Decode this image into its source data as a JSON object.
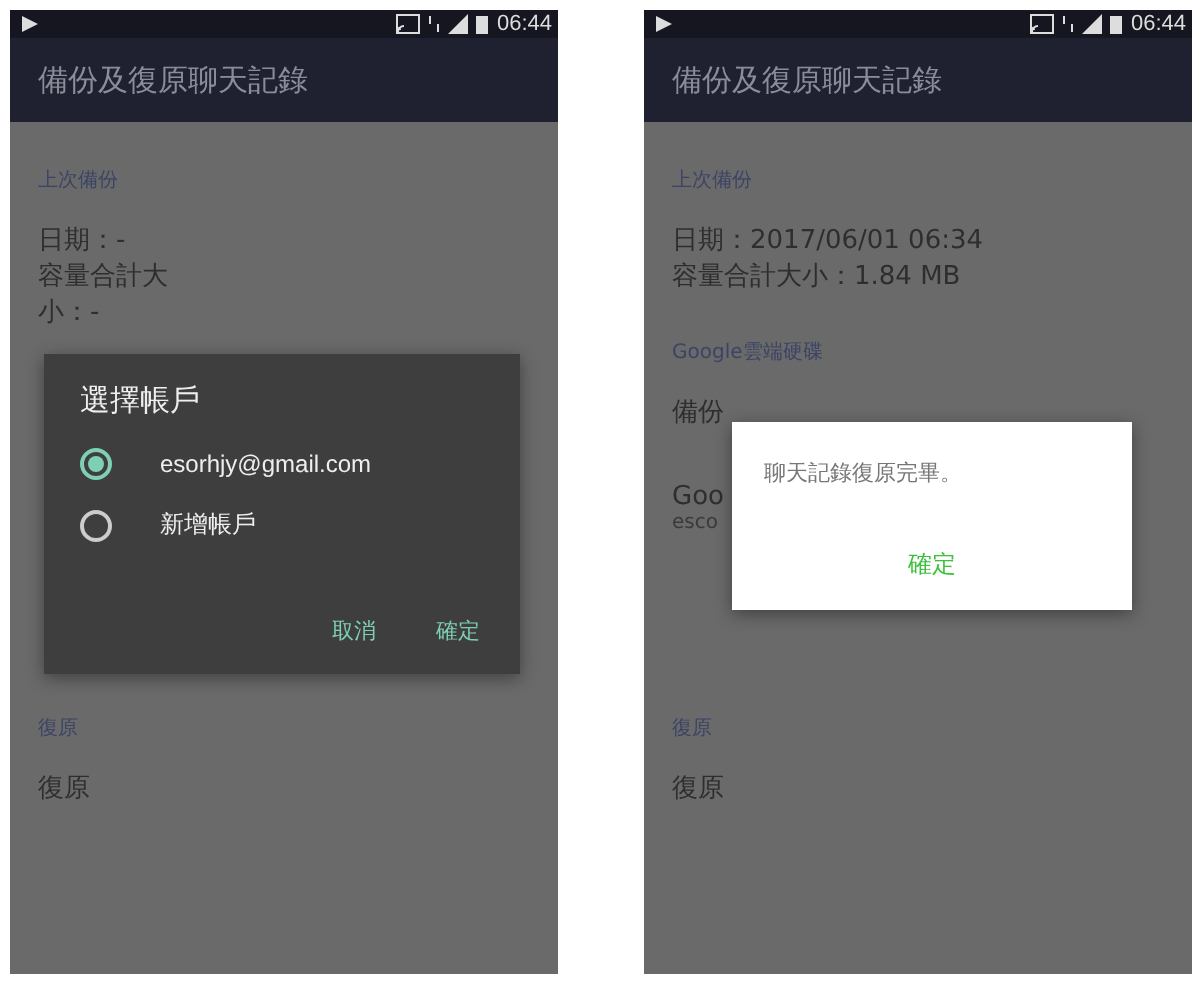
{
  "phones": [
    {
      "status_bar": {
        "time": "06:44"
      },
      "title": "備份及復原聊天記錄",
      "sections": [
        {
          "header": "上次備份",
          "items": [
            {
              "title": "日期：-"
            },
            {
              "title": "容量合計大"
            },
            {
              "title": "小：-"
            }
          ]
        }
      ],
      "restore": {
        "header": "復原",
        "item": "復原"
      },
      "dialog": {
        "kind": "account_picker",
        "title": "選擇帳戶",
        "options": [
          {
            "label": "esorhjy@gmail.com",
            "selected": true
          },
          {
            "label": "新增帳戶",
            "selected": false
          }
        ],
        "buttons": [
          "取消",
          "確定"
        ]
      }
    },
    {
      "status_bar": {
        "time": "06:44"
      },
      "title": "備份及復原聊天記錄",
      "sections": [
        {
          "header": "上次備份",
          "items": [
            {
              "title": "日期：2017/06/01 06:34"
            },
            {
              "title": "容量合計大小：1.84 MB"
            }
          ]
        },
        {
          "header": "Google雲端硬碟",
          "kind": "list",
          "items": [
            {
              "title": "備份"
            },
            {
              "title": "Goo",
              "subtitle": "esco"
            }
          ]
        }
      ],
      "restore": {
        "header": "復原",
        "item": "復原"
      },
      "dialog": {
        "kind": "message",
        "message": "聊天記錄復原完畢。",
        "buttons": [
          "確定"
        ]
      }
    }
  ]
}
